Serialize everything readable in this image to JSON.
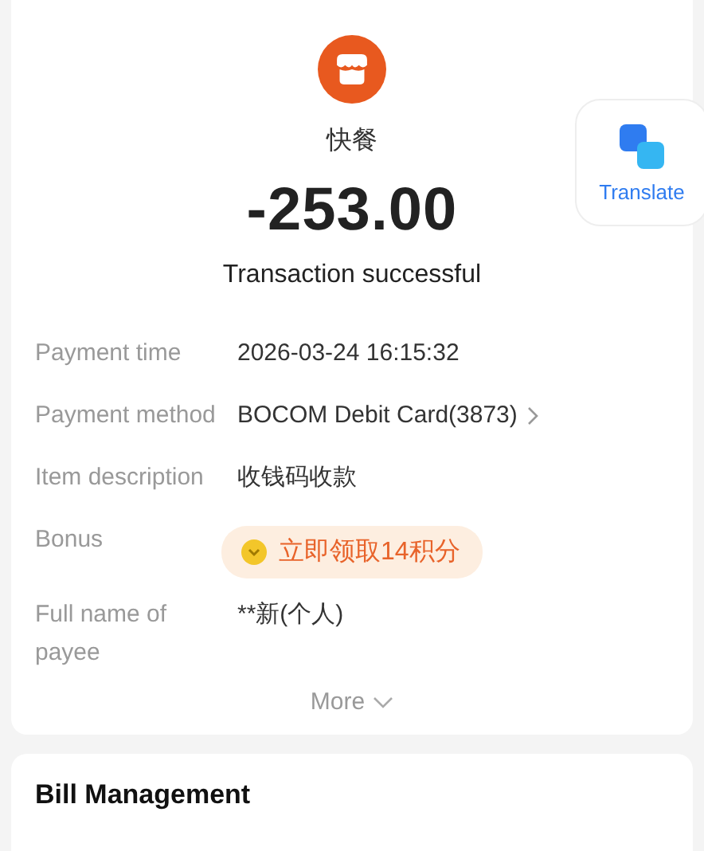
{
  "merchant": {
    "name": "快餐"
  },
  "amount": "-253.00",
  "status": "Transaction successful",
  "translate": {
    "label": "Translate"
  },
  "details": [
    {
      "kind": "text",
      "label": "Payment time",
      "value": "2026-03-24 16:15:32"
    },
    {
      "kind": "link",
      "label": "Payment method",
      "value": "BOCOM Debit Card(3873)"
    },
    {
      "kind": "text",
      "label": "Item description",
      "value": "收钱码收款"
    },
    {
      "kind": "bonus",
      "label": "Bonus",
      "value": "立即领取14积分"
    },
    {
      "kind": "text",
      "label": "Full name of payee",
      "value": "**新(个人)"
    }
  ],
  "more": "More",
  "bill_management": {
    "title": "Bill Management"
  }
}
